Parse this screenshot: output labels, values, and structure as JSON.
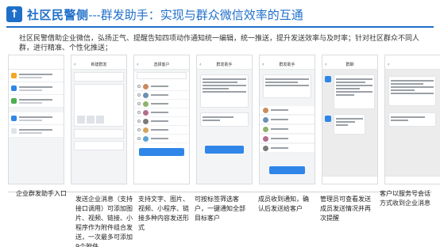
{
  "header": {
    "badge": "↑",
    "title_main": "社区民警侧",
    "title_sub": "---群发助手：实现与群众微信效率的互通"
  },
  "intro": "社区民警借助企业微信，弘扬正气、提醒告知四项动作通知统一编辑，统一推送，提升发送效率与及时率；针对社区群众不同人群，进行精准、个性化推送；",
  "screens": [
    {
      "nav": "",
      "name": "home"
    },
    {
      "nav": "新建群发",
      "name": "compose"
    },
    {
      "nav": "选择客户",
      "name": "select-customer"
    },
    {
      "nav": "群发助手",
      "name": "confirm"
    },
    {
      "nav": "群发助手",
      "name": "notice"
    },
    {
      "nav": "群聊",
      "name": "chat"
    }
  ],
  "captions": [
    "企业群发助手入口",
    "发送企业消息（支持接口调用）可添加图片、视频、链接、小程序作为附件组合发送，一次最多可添加9个附件",
    "支持文字、图片、视频、小程序、链接多种内容发送形式",
    "可按标签筛选客户，一键通知全部目标客户",
    "成员收到通知，确认后发送给客户",
    "管理员可查看发送成员发送情况并再次提醒",
    "客户以服务号会话方式收到企业消息"
  ],
  "colors": {
    "brand": "#1f6fc9",
    "button": "#2f86e8",
    "chat_green": "#a5e36f"
  }
}
